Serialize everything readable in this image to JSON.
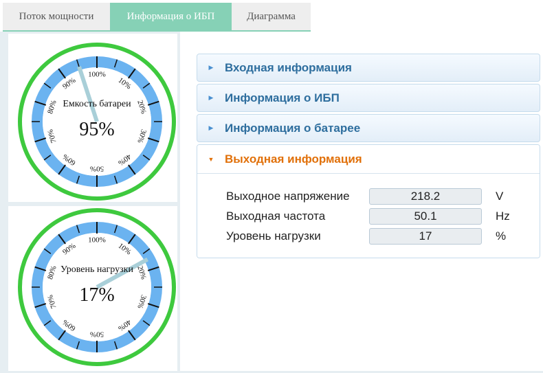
{
  "tabs": [
    {
      "label": "Поток мощности"
    },
    {
      "label": "Информация о ИБП"
    },
    {
      "label": "Диаграмма"
    }
  ],
  "gauges": [
    {
      "label": "Емкость батареи",
      "value": 95,
      "value_text": "95%",
      "ticks": [
        "100%",
        "10%",
        "20%",
        "30%",
        "40%",
        "50%",
        "60%",
        "70%",
        "80%",
        "90%"
      ]
    },
    {
      "label": "Уровень нагрузки",
      "value": 17,
      "value_text": "17%",
      "ticks": [
        "100%",
        "10%",
        "20%",
        "30%",
        "40%",
        "50%",
        "60%",
        "70%",
        "80%",
        "90%"
      ]
    }
  ],
  "accordion": {
    "sections": [
      {
        "title": "Входная информация"
      },
      {
        "title": "Информация о ИБП"
      },
      {
        "title": "Информация о батарее"
      }
    ],
    "open": {
      "title": "Выходная информация",
      "rows": [
        {
          "label": "Выходное напряжение",
          "value": "218.2",
          "unit": "V"
        },
        {
          "label": "Выходная частота",
          "value": "50.1",
          "unit": "Hz"
        },
        {
          "label": "Уровень нагрузки",
          "value": "17",
          "unit": "%"
        }
      ]
    }
  },
  "colors": {
    "tab_active": "#86d1b6",
    "gauge_ring": "#3ec93e",
    "gauge_band": "#6bb3f0",
    "gauge_needle": "#a9cfd8",
    "accordion_title": "#2e6e9e",
    "accordion_active_title": "#e17009"
  }
}
